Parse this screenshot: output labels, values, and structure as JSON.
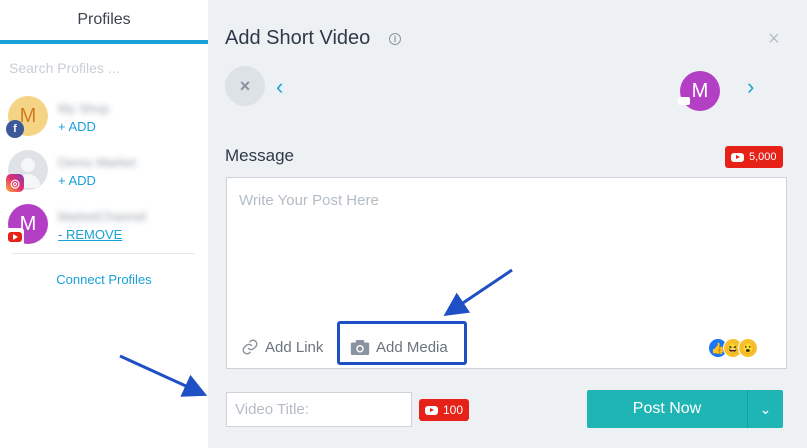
{
  "sidebar": {
    "title": "Profiles",
    "search_placeholder": "Search Profiles ...",
    "profiles": [
      {
        "avatar_letter": "M",
        "name": "My Shop",
        "network": "facebook",
        "action": "+ ADD"
      },
      {
        "avatar_letter": "",
        "name": "Demo Market",
        "network": "instagram",
        "action": "+ ADD"
      },
      {
        "avatar_letter": "M",
        "name": "MarketChannel",
        "network": "youtube",
        "action": "- REMOVE"
      }
    ],
    "connect_label": "Connect Profiles"
  },
  "dialog": {
    "title": "Add Short Video",
    "info_icon": "i",
    "close_icon": "×",
    "remove_icon": "×",
    "prev_arrow": "‹",
    "next_arrow": "›",
    "selected_avatar_letter": "M",
    "message_label": "Message",
    "message_limit": "5,000",
    "message_placeholder": "Write Your Post Here",
    "add_link_label": "Add Link",
    "add_media_label": "Add Media",
    "video_title_placeholder": "Video Title:",
    "video_title_limit": "100",
    "post_now_label": "Post Now",
    "dropdown_icon": "⌄"
  },
  "colors": {
    "accent": "#1aa0d9",
    "post_button": "#1fb5b5",
    "youtube_red": "#e62117",
    "annotation_blue": "#1f4fc4"
  }
}
